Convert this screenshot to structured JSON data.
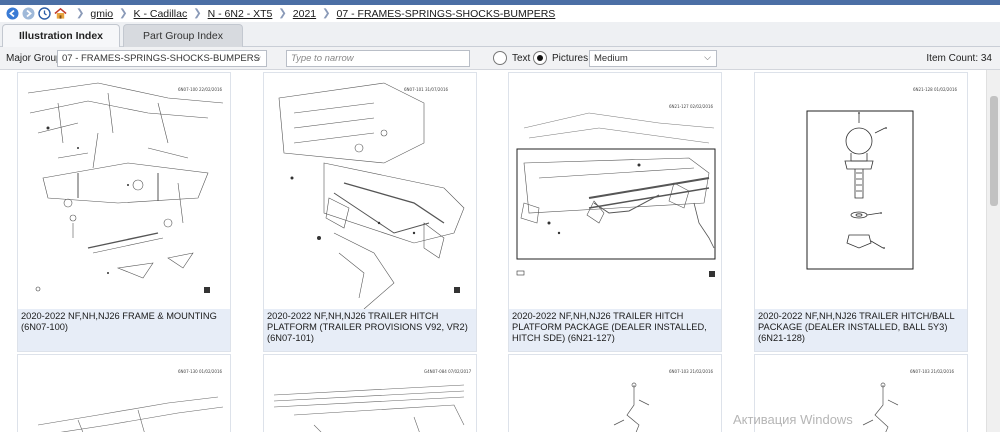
{
  "breadcrumb": {
    "icons": [
      "back-icon",
      "forward-icon",
      "history-icon",
      "home-icon"
    ],
    "items": [
      "gmio",
      "K - Cadillac",
      "N - 6N2 - XT5",
      "2021",
      "07 - FRAMES-SPRINGS-SHOCKS-BUMPERS"
    ]
  },
  "tabs": {
    "illustration": "Illustration Index",
    "part_group": "Part Group Index"
  },
  "filter": {
    "major_group_label": "Major Group:",
    "major_group_value": "07 - FRAMES-SPRINGS-SHOCKS-BUMPERS",
    "narrow_placeholder": "Type to narrow",
    "text_label": "Text",
    "pictures_label": "Pictures",
    "size_value": "Medium",
    "item_count": "Item Count: 34"
  },
  "cards": [
    {
      "code": "6N07-100 22/02/2016",
      "caption": "2020-2022   NF,NH,NJ26   FRAME & MOUNTING (6N07-100)"
    },
    {
      "code": "6N07-101 31/07/2016",
      "caption": "2020-2022   NF,NH,NJ26   TRAILER HITCH PLATFORM (TRAILER PROVISIONS V92, VR2) (6N07-101)"
    },
    {
      "code": "6N21-127 02/02/2016",
      "caption": "2020-2022   NF,NH,NJ26   TRAILER HITCH PLATFORM PACKAGE (DEALER INSTALLED, HITCH SDE)   (6N21-127)"
    },
    {
      "code": "6N21-128 01/02/2016",
      "caption": "2020-2022   NF,NH,NJ26   TRAILER HITCH/BALL PACKAGE (DEALER INSTALLED, BALL 5Y3)   (6N21-128)"
    }
  ],
  "row2_codes": [
    "6N07-130 01/02/2016",
    "G4N07-084 07/02/2017",
    "6N07-103 21/02/2016",
    "6N07-103 21/02/2016"
  ],
  "watermark": "Активация Windows",
  "colors": {
    "topbar": "#4b6fa5",
    "caption_bg": "#e7edf7"
  }
}
